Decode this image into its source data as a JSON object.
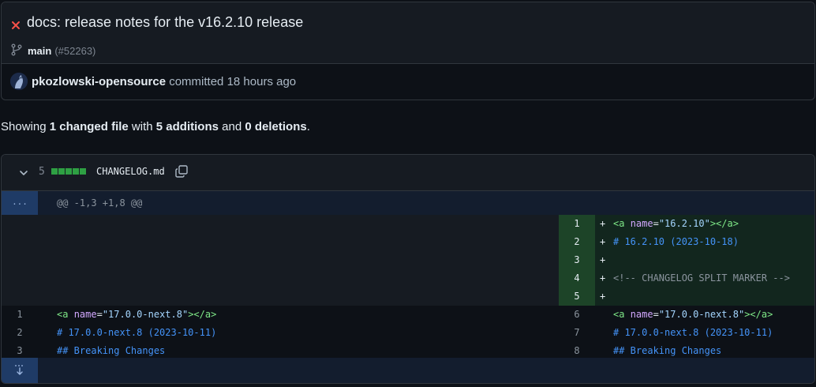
{
  "commit": {
    "title": "docs: release notes for the v16.2.10 release",
    "branch": "main",
    "pr_ref": "(#52263)",
    "author": "pkozlowski-opensource",
    "action": "committed",
    "time": "18 hours ago"
  },
  "summary": {
    "prefix": "Showing",
    "files": "1 changed file",
    "with": "with",
    "additions": "5 additions",
    "and": "and",
    "deletions": "0 deletions",
    "end": "."
  },
  "file": {
    "change_count": "5",
    "name": "CHANGELOG.md",
    "diffstat_added_blocks": 5
  },
  "diff": {
    "expand_top_label": "...",
    "hunk_header": "@@ -1,3 +1,8 @@",
    "added_lines": [
      {
        "num": "1",
        "marker": "+",
        "text": "<a name=\"16.2.10\"></a>"
      },
      {
        "num": "2",
        "marker": "+",
        "text": "# 16.2.10 (2023-10-18)"
      },
      {
        "num": "3",
        "marker": "+",
        "text": ""
      },
      {
        "num": "4",
        "marker": "+",
        "text": "<!-- CHANGELOG SPLIT MARKER -->"
      },
      {
        "num": "5",
        "marker": "+",
        "text": ""
      }
    ],
    "context_lines": [
      {
        "left_num": "1",
        "right_num": "6",
        "text": "<a name=\"17.0.0-next.8\"></a>"
      },
      {
        "left_num": "2",
        "right_num": "7",
        "text": "# 17.0.0-next.8 (2023-10-11)"
      },
      {
        "left_num": "3",
        "right_num": "8",
        "text": "## Breaking Changes"
      }
    ]
  },
  "colors": {
    "bg": "#0d1117",
    "added_bg": "#12261e",
    "added_num_bg": "#1d4428",
    "diffstat_green": "#2ea043",
    "fail_red": "#f85149"
  },
  "icons": [
    "x-icon",
    "branch-icon",
    "avatar",
    "chevron-down-icon",
    "copy-icon",
    "unfold-icon"
  ]
}
